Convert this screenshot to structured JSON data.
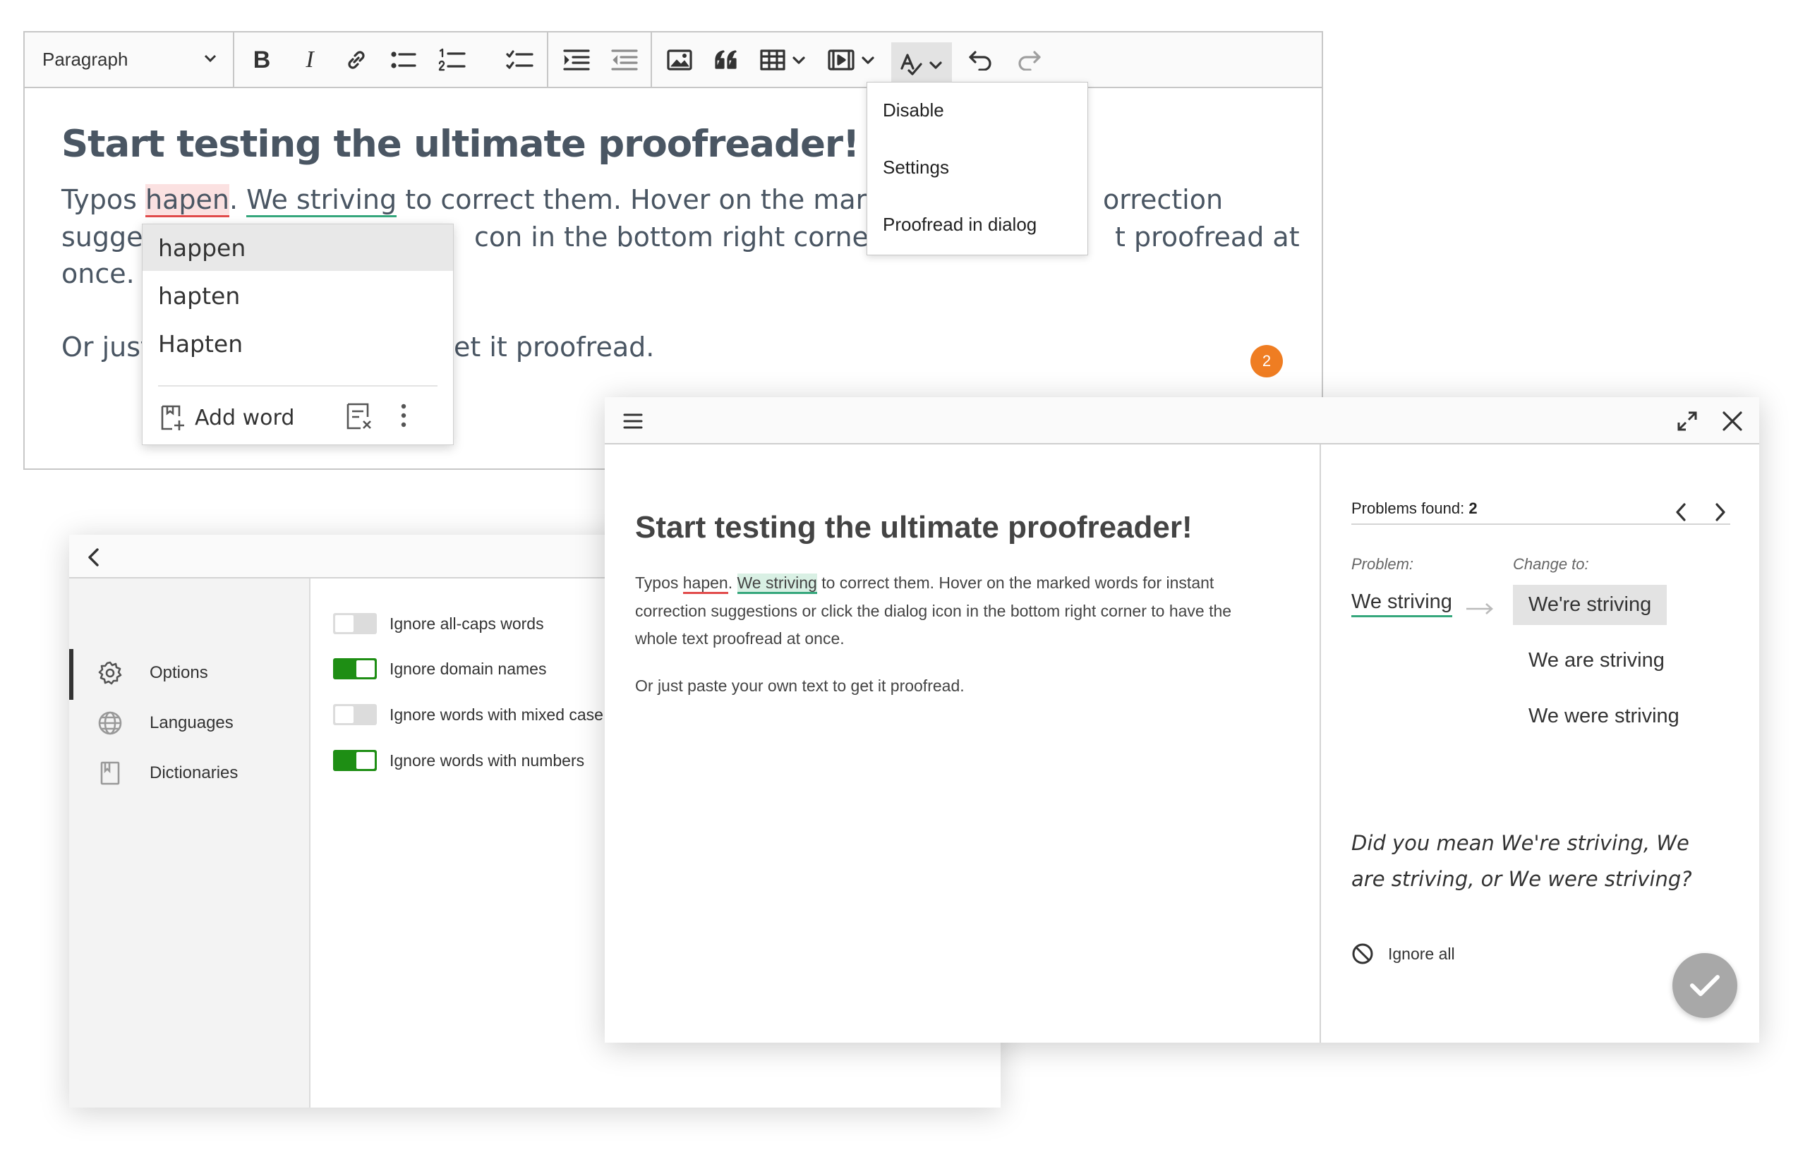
{
  "toolbar": {
    "paragraph_select": "Paragraph",
    "icons": [
      "bold-icon",
      "italic-icon",
      "link-icon",
      "bulleted-list-icon",
      "numbered-list-icon",
      "todo-list-icon",
      "indent-icon",
      "outdent-icon",
      "image-icon",
      "quote-icon",
      "table-icon",
      "media-icon",
      "spellcheck-icon",
      "undo-icon",
      "redo-icon"
    ]
  },
  "editor": {
    "title": "Start testing the ultimate proofreader!",
    "line1_start": "Typos ",
    "typo_word": "hapen",
    "line1_dot": ". ",
    "grammar_phrase": "We striving",
    "line1_end": " to correct them. Hover on the marked v",
    "line1_hidden_tail": "orrection",
    "line2_visible_left": "sugges",
    "line2_mid": "con in the bottom right corner to h",
    "line2_right": "t proofread at",
    "line3": "once.",
    "line4_left": "Or just",
    "line4_right": "et it proofread.",
    "issues_badge": "2"
  },
  "suggestions": {
    "items": [
      "happen",
      "hapten",
      "Hapten"
    ],
    "add_word": "Add word"
  },
  "spell_menu": {
    "items": [
      "Disable",
      "Settings",
      "Proofread in dialog"
    ]
  },
  "settings": {
    "sidebar": [
      {
        "label": "Options",
        "icon": "gear-icon"
      },
      {
        "label": "Languages",
        "icon": "globe-icon"
      },
      {
        "label": "Dictionaries",
        "icon": "book-icon"
      }
    ],
    "options": [
      {
        "label": "Ignore all-caps words",
        "on": false
      },
      {
        "label": "Ignore domain names",
        "on": true
      },
      {
        "label": "Ignore words with mixed case",
        "on": false
      },
      {
        "label": "Ignore words with numbers",
        "on": true
      }
    ]
  },
  "dialog": {
    "title": "Start testing the ultimate proofreader!",
    "p1_a": "Typos ",
    "p1_typo": "hapen",
    "p1_b": ". ",
    "p1_gram": "We striving",
    "p1_c": " to correct them. Hover on the marked words for instant",
    "p2": "correction suggestions or click the dialog icon in the bottom right corner to have the",
    "p3": "whole text proofread at once.",
    "p4": "Or just paste your own text to get it proofread.",
    "problems_found_label": "Problems found: ",
    "problems_found_count": "2",
    "problem_label": "Problem:",
    "change_to_label": "Change to:",
    "problem_word": "We striving",
    "change_options": [
      "We're striving",
      "We are striving",
      "We were striving"
    ],
    "did_you_mean": "Did you mean We're striving, We are striving, or We were striving?",
    "ignore_all": "Ignore all"
  }
}
